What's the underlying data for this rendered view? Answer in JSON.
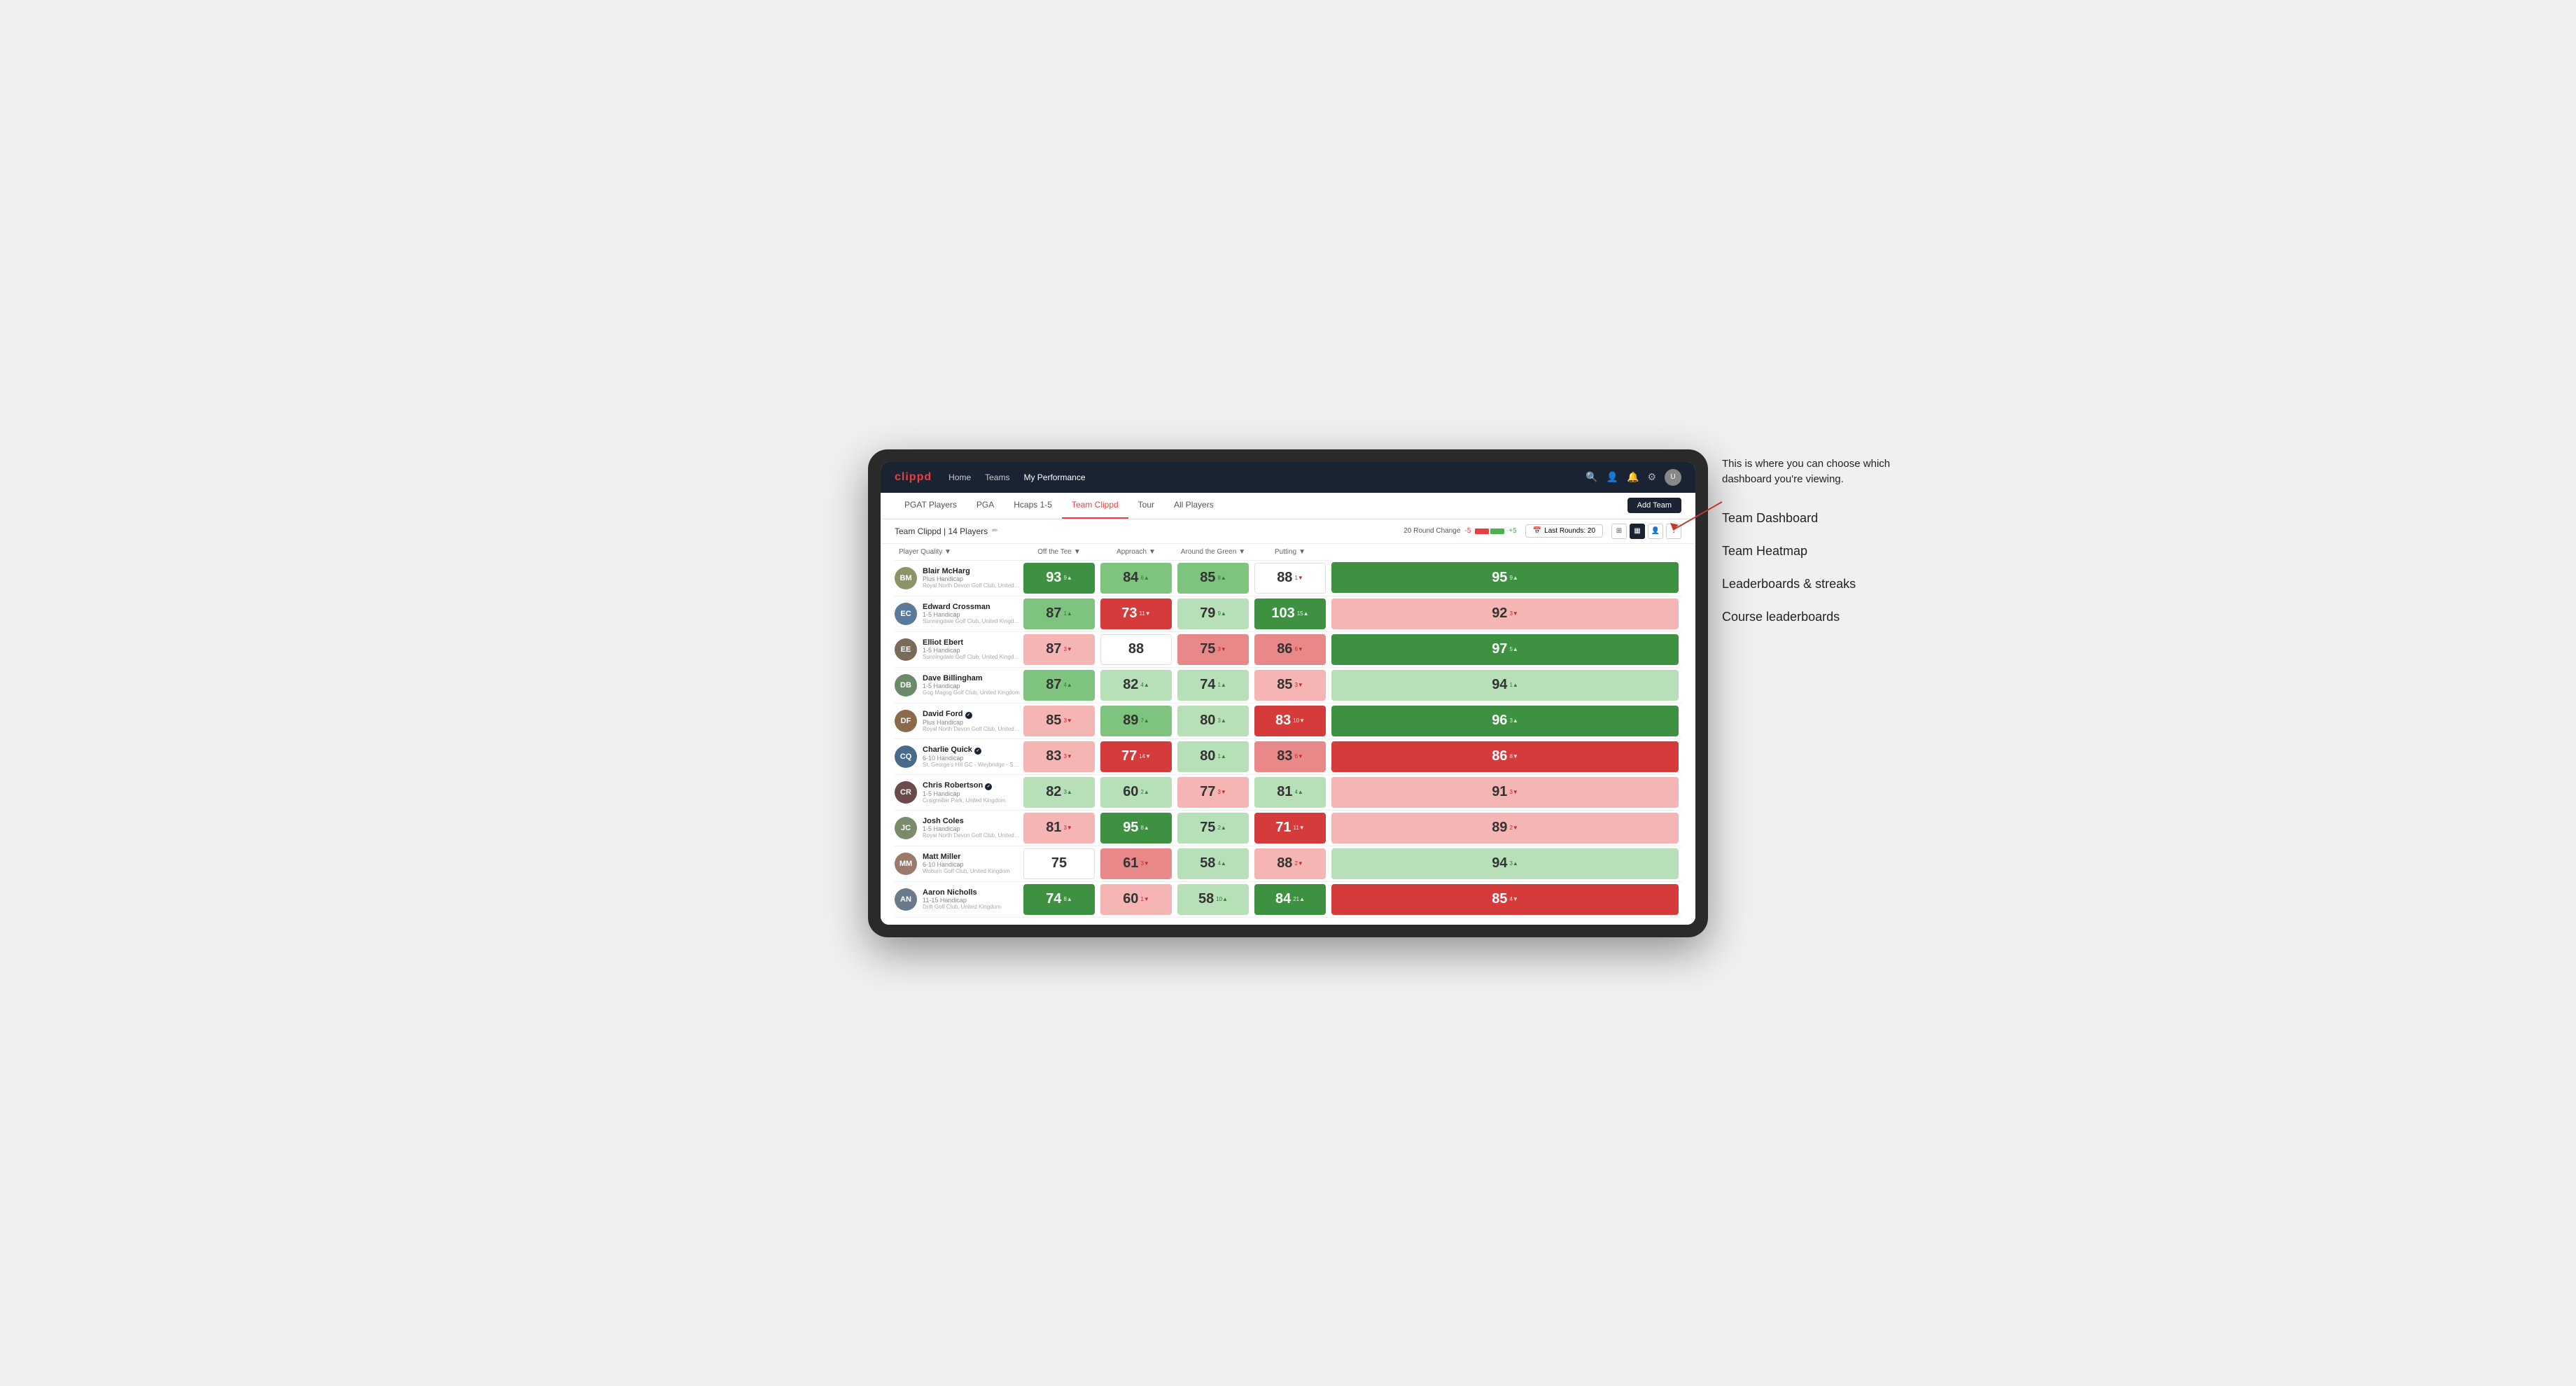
{
  "annotation": {
    "intro": "This is where you can choose which dashboard you're viewing.",
    "items": [
      "Team Dashboard",
      "Team Heatmap",
      "Leaderboards & streaks",
      "Course leaderboards"
    ]
  },
  "nav": {
    "logo": "clippd",
    "links": [
      {
        "label": "Home",
        "active": false
      },
      {
        "label": "Teams",
        "active": false
      },
      {
        "label": "My Performance",
        "active": true
      }
    ],
    "icons": [
      "search",
      "user",
      "bell",
      "settings",
      "avatar"
    ]
  },
  "subnav": {
    "links": [
      {
        "label": "PGAT Players",
        "active": false
      },
      {
        "label": "PGA",
        "active": false
      },
      {
        "label": "Hcaps 1-5",
        "active": false
      },
      {
        "label": "Team Clippd",
        "active": true
      },
      {
        "label": "Tour",
        "active": false
      },
      {
        "label": "All Players",
        "active": false
      }
    ],
    "add_team_label": "Add Team"
  },
  "team_bar": {
    "name": "Team Clippd",
    "count": "14 Players",
    "round_change_label": "20 Round Change",
    "neg_label": "-5",
    "pos_label": "+5",
    "last_rounds_label": "Last Rounds:",
    "last_rounds_value": "20"
  },
  "table": {
    "columns": [
      {
        "key": "player",
        "label": "Player Quality ↓"
      },
      {
        "key": "tee",
        "label": "Off the Tee ↓"
      },
      {
        "key": "approach",
        "label": "Approach ↓"
      },
      {
        "key": "around_green",
        "label": "Around the Green ↓"
      },
      {
        "key": "putting",
        "label": "Putting ↓"
      }
    ],
    "rows": [
      {
        "name": "Blair McHarg",
        "handicap": "Plus Handicap",
        "club": "Royal North Devon Golf Club, United Kingdom",
        "avatar_bg": "#8B9467",
        "initials": "BM",
        "tee_val": "93",
        "tee_change": "9▲",
        "tee_bg": "green-dark",
        "tee_text": "white",
        "approach_val": "84",
        "approach_change": "6▲",
        "approach_bg": "green-light",
        "approach_text": "dark",
        "around_val": "85",
        "around_change": "8▲",
        "around_bg": "green-light",
        "around_text": "dark",
        "green_val": "88",
        "green_change": "1▼",
        "green_bg": "white",
        "green_text": "dark",
        "putting_val": "95",
        "putting_change": "9▲",
        "putting_bg": "green-dark",
        "putting_text": "white"
      },
      {
        "name": "Edward Crossman",
        "handicap": "1-5 Handicap",
        "club": "Sunningdale Golf Club, United Kingdom",
        "avatar_bg": "#5a7a9a",
        "initials": "EC",
        "tee_val": "87",
        "tee_change": "1▲",
        "tee_bg": "green-light",
        "tee_text": "dark",
        "approach_val": "73",
        "approach_change": "11▼",
        "approach_bg": "red-dark",
        "approach_text": "white",
        "around_val": "79",
        "around_change": "9▲",
        "around_bg": "light-green",
        "around_text": "dark",
        "green_val": "103",
        "green_change": "15▲",
        "green_bg": "green-dark",
        "green_text": "white",
        "putting_val": "92",
        "putting_change": "3▼",
        "putting_bg": "light-red",
        "putting_text": "dark"
      },
      {
        "name": "Elliot Ebert",
        "handicap": "1-5 Handicap",
        "club": "Sunningdale Golf Club, United Kingdom",
        "avatar_bg": "#7a6a5a",
        "initials": "EE",
        "tee_val": "87",
        "tee_change": "3▼",
        "tee_bg": "light-red",
        "tee_text": "dark",
        "approach_val": "88",
        "approach_change": "",
        "approach_bg": "white",
        "approach_text": "dark",
        "around_val": "75",
        "around_change": "3▼",
        "around_bg": "red-light",
        "around_text": "dark",
        "green_val": "86",
        "green_change": "6▼",
        "green_bg": "red-light",
        "green_text": "dark",
        "putting_val": "97",
        "putting_change": "5▲",
        "putting_bg": "green-dark",
        "putting_text": "white"
      },
      {
        "name": "Dave Billingham",
        "handicap": "1-5 Handicap",
        "club": "Gog Magog Golf Club, United Kingdom",
        "avatar_bg": "#6a8a6a",
        "initials": "DB",
        "tee_val": "87",
        "tee_change": "4▲",
        "tee_bg": "green-light",
        "tee_text": "dark",
        "approach_val": "82",
        "approach_change": "4▲",
        "approach_bg": "light-green",
        "approach_text": "dark",
        "around_val": "74",
        "around_change": "1▲",
        "around_bg": "light-green",
        "around_text": "dark",
        "green_val": "85",
        "green_change": "3▼",
        "green_bg": "light-red",
        "green_text": "dark",
        "putting_val": "94",
        "putting_change": "1▲",
        "putting_bg": "light-green",
        "putting_text": "dark"
      },
      {
        "name": "David Ford",
        "handicap": "Plus Handicap",
        "club": "Royal North Devon Golf Club, United Kingdom",
        "avatar_bg": "#8a6a4a",
        "initials": "DF",
        "badge": true,
        "tee_val": "85",
        "tee_change": "3▼",
        "tee_bg": "light-red",
        "tee_text": "dark",
        "approach_val": "89",
        "approach_change": "7▲",
        "approach_bg": "green-light",
        "approach_text": "dark",
        "around_val": "80",
        "around_change": "3▲",
        "around_bg": "light-green",
        "around_text": "dark",
        "green_val": "83",
        "green_change": "10▼",
        "green_bg": "red-dark",
        "green_text": "white",
        "putting_val": "96",
        "putting_change": "3▲",
        "putting_bg": "green-dark",
        "putting_text": "white"
      },
      {
        "name": "Charlie Quick",
        "handicap": "6-10 Handicap",
        "club": "St. George's Hill GC - Weybridge - Surrey, Uni...",
        "avatar_bg": "#4a6a8a",
        "initials": "CQ",
        "badge": true,
        "tee_val": "83",
        "tee_change": "3▼",
        "tee_bg": "light-red",
        "tee_text": "dark",
        "approach_val": "77",
        "approach_change": "14▼",
        "approach_bg": "red-dark",
        "approach_text": "white",
        "around_val": "80",
        "around_change": "1▲",
        "around_bg": "light-green",
        "around_text": "dark",
        "green_val": "83",
        "green_change": "6▼",
        "green_bg": "red-light",
        "green_text": "dark",
        "putting_val": "86",
        "putting_change": "8▼",
        "putting_bg": "red-dark",
        "putting_text": "white"
      },
      {
        "name": "Chris Robertson",
        "handicap": "1-5 Handicap",
        "club": "Craigmillar Park, United Kingdom",
        "avatar_bg": "#6a4a4a",
        "initials": "CR",
        "badge": true,
        "tee_val": "82",
        "tee_change": "3▲",
        "tee_bg": "light-green",
        "tee_text": "dark",
        "approach_val": "60",
        "approach_change": "2▲",
        "approach_bg": "light-green",
        "approach_text": "dark",
        "around_val": "77",
        "around_change": "3▼",
        "around_bg": "light-red",
        "around_text": "dark",
        "green_val": "81",
        "green_change": "4▲",
        "green_bg": "light-green",
        "green_text": "dark",
        "putting_val": "91",
        "putting_change": "3▼",
        "putting_bg": "light-red",
        "putting_text": "dark"
      },
      {
        "name": "Josh Coles",
        "handicap": "1-5 Handicap",
        "club": "Royal North Devon Golf Club, United Kingdom",
        "avatar_bg": "#7a8a6a",
        "initials": "JC",
        "tee_val": "81",
        "tee_change": "3▼",
        "tee_bg": "light-red",
        "tee_text": "dark",
        "approach_val": "95",
        "approach_change": "8▲",
        "approach_bg": "green-dark",
        "approach_text": "white",
        "around_val": "75",
        "around_change": "2▲",
        "around_bg": "light-green",
        "around_text": "dark",
        "green_val": "71",
        "green_change": "11▼",
        "green_bg": "red-dark",
        "green_text": "white",
        "putting_val": "89",
        "putting_change": "2▼",
        "putting_bg": "light-red",
        "putting_text": "dark"
      },
      {
        "name": "Matt Miller",
        "handicap": "6-10 Handicap",
        "club": "Woburn Golf Club, United Kingdom",
        "avatar_bg": "#9a7a6a",
        "initials": "MM",
        "tee_val": "75",
        "tee_change": "",
        "tee_bg": "white",
        "tee_text": "dark",
        "approach_val": "61",
        "approach_change": "3▼",
        "approach_bg": "red-light",
        "approach_text": "dark",
        "around_val": "58",
        "around_change": "4▲",
        "around_bg": "light-green",
        "around_text": "dark",
        "green_val": "88",
        "green_change": "2▼",
        "green_bg": "light-red",
        "green_text": "dark",
        "putting_val": "94",
        "putting_change": "3▲",
        "putting_bg": "light-green",
        "putting_text": "dark"
      },
      {
        "name": "Aaron Nicholls",
        "handicap": "11-15 Handicap",
        "club": "Drift Golf Club, United Kingdom",
        "avatar_bg": "#6a7a8a",
        "initials": "AN",
        "tee_val": "74",
        "tee_change": "8▲",
        "tee_bg": "green-dark",
        "tee_text": "white",
        "approach_val": "60",
        "approach_change": "1▼",
        "approach_bg": "light-red",
        "approach_text": "dark",
        "around_val": "58",
        "around_change": "10▲",
        "around_bg": "light-green",
        "around_text": "dark",
        "green_val": "84",
        "green_change": "21▲",
        "green_bg": "green-dark",
        "green_text": "white",
        "putting_val": "85",
        "putting_change": "4▼",
        "putting_bg": "red-dark",
        "putting_text": "white"
      }
    ]
  }
}
